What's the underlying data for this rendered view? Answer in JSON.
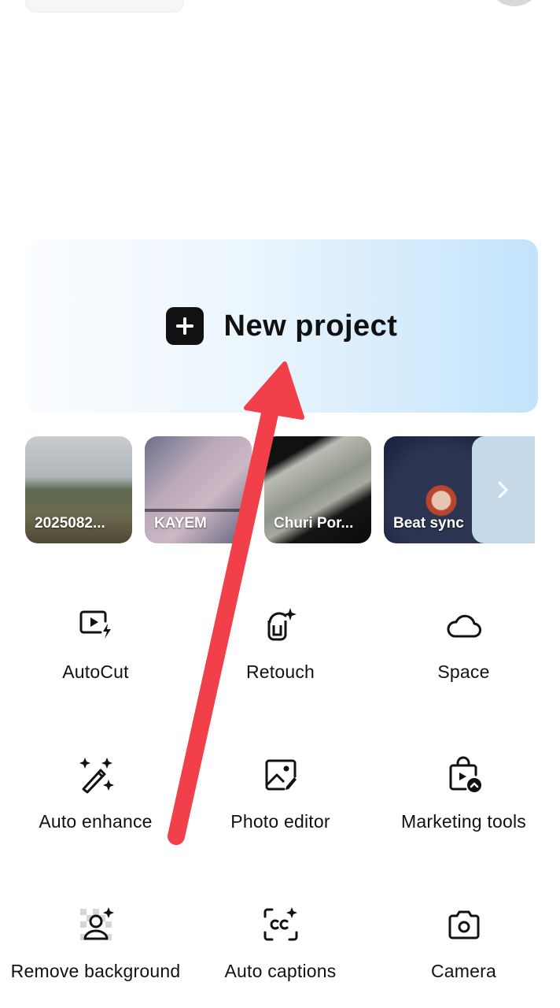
{
  "new_project": {
    "label": "New project",
    "icon": "plus-square-icon"
  },
  "drafts": [
    {
      "title": "2025082..."
    },
    {
      "title": "KAYEM"
    },
    {
      "title": "Churi Por..."
    },
    {
      "title": "Beat sync"
    }
  ],
  "drafts_more_icon": "chevron-right-icon",
  "tools": [
    {
      "label": "AutoCut",
      "icon": "autocut-icon"
    },
    {
      "label": "Retouch",
      "icon": "retouch-icon"
    },
    {
      "label": "Space",
      "icon": "cloud-icon"
    },
    {
      "label": "Auto enhance",
      "icon": "magic-wand-icon"
    },
    {
      "label": "Photo editor",
      "icon": "photo-edit-icon"
    },
    {
      "label": "Marketing tools",
      "icon": "shopping-bag-icon"
    },
    {
      "label": "Remove background",
      "icon": "remove-background-icon"
    },
    {
      "label": "Auto captions",
      "icon": "captions-icon"
    },
    {
      "label": "Camera",
      "icon": "camera-icon"
    }
  ],
  "colors": {
    "annotation_arrow": "#f2404a",
    "banner_gradient_end": "#c2e3fb",
    "text_primary": "#111111"
  }
}
